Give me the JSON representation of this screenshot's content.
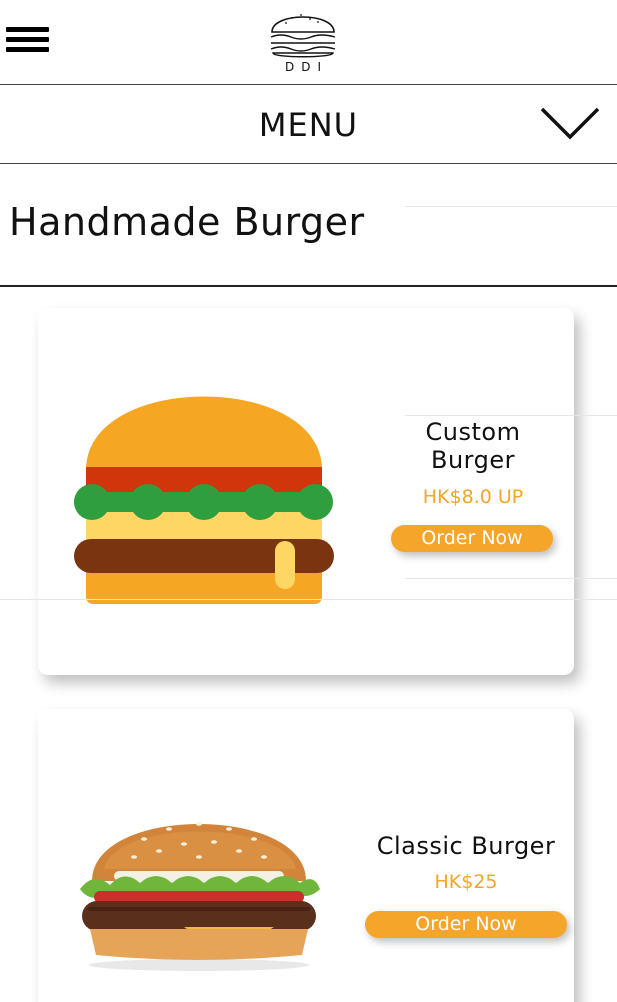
{
  "header": {
    "logo_text": "DDI",
    "menu_title": "MENU"
  },
  "section": {
    "title": "Handmade Burger"
  },
  "products": [
    {
      "name_line1": "Custom",
      "name_line2": "Burger",
      "price": "HK$8.0 UP",
      "order_label": "Order Now",
      "image": "burger-illustration"
    },
    {
      "name": "Classic Burger",
      "price": "HK$25",
      "order_label": "Order Now",
      "image": "burger-photo"
    }
  ],
  "colors": {
    "accent": "#f4a52a",
    "bun": "#f5a623",
    "lettuce": "#2e9e3e",
    "tomato": "#d0350b",
    "cheese": "#fdd663",
    "patty": "#7a3410"
  }
}
